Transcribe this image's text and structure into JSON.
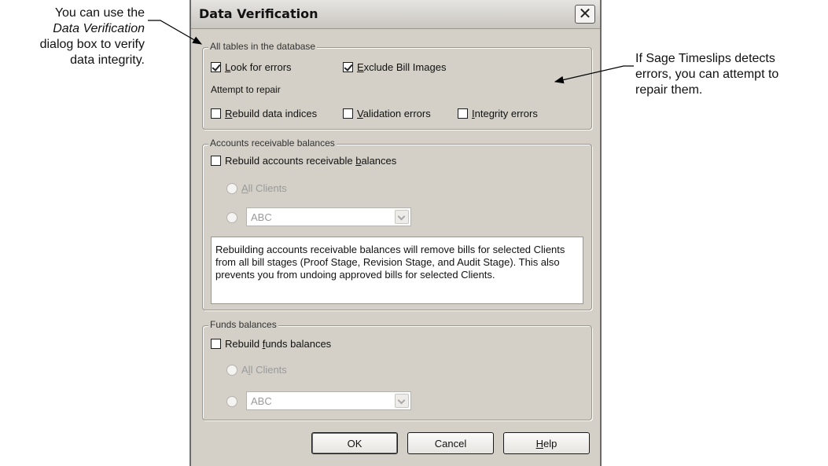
{
  "callouts": {
    "left": {
      "line1": "You can use the",
      "line2": "Data Verification",
      "line3": "dialog box to verify",
      "line4": "data integrity."
    },
    "right": {
      "line1": "If Sage Timeslips detects",
      "line2": "errors, you can attempt to",
      "line3": "repair them."
    }
  },
  "dialog": {
    "title": "Data Verification",
    "close_glyph": "✕",
    "tables_group": {
      "label": "All tables in the database",
      "look_for_errors": {
        "pre": "",
        "key": "L",
        "post": "ook for errors",
        "checked": true
      },
      "exclude_bill_images": {
        "pre": "",
        "key": "E",
        "post": "xclude Bill Images",
        "checked": true
      },
      "attempt_label": "Attempt to repair",
      "rebuild_indices": {
        "pre": "",
        "key": "R",
        "post": "ebuild data indices",
        "checked": false
      },
      "validation_errors": {
        "pre": "",
        "key": "V",
        "post": "alidation errors",
        "checked": false
      },
      "integrity_errors": {
        "pre": "",
        "key": "I",
        "post": "ntegrity errors",
        "checked": false
      }
    },
    "ar_group": {
      "label": "Accounts receivable balances",
      "rebuild": {
        "pre": "Rebuild accounts receivable ",
        "key": "b",
        "post": "alances",
        "checked": false
      },
      "all_clients": {
        "pre": "",
        "key": "A",
        "post": "ll Clients"
      },
      "client_select": {
        "value": "ABC"
      },
      "note": "Rebuilding accounts receivable balances will remove bills for selected Clients from all bill stages (Proof Stage, Revision Stage, and Audit Stage). This also prevents you from undoing approved bills for selected Clients."
    },
    "funds_group": {
      "label": "Funds balances",
      "rebuild": {
        "pre": "Rebuild ",
        "key": "f",
        "post": "unds balances",
        "checked": false
      },
      "all_clients": {
        "pre": "A",
        "key": "l",
        "post": "l Clients"
      },
      "client_select": {
        "value": "ABC"
      }
    },
    "buttons": {
      "ok": "OK",
      "cancel": "Cancel",
      "help": {
        "pre": "",
        "key": "H",
        "post": "elp"
      }
    }
  }
}
